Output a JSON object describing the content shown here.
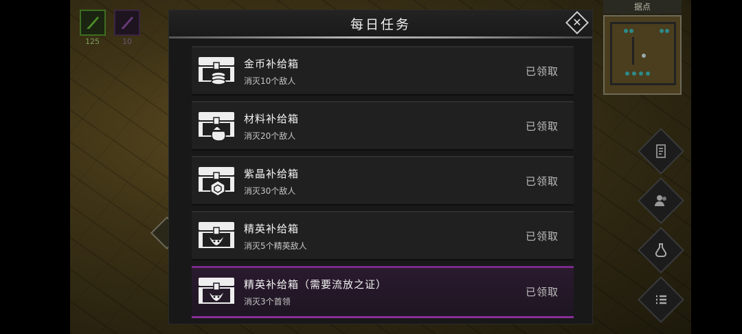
{
  "hud": {
    "skill_1_count": "125",
    "skill_2_count": "10",
    "minimap_title": "据点"
  },
  "dialog": {
    "title": "每日任务",
    "close_glyph": "✕"
  },
  "quests": [
    {
      "name": "金币补给箱",
      "desc": "消灭10个敌人",
      "status": "已领取",
      "icon": "coin-chest-icon"
    },
    {
      "name": "材料补给箱",
      "desc": "消灭20个敌人",
      "status": "已领取",
      "icon": "material-chest-icon"
    },
    {
      "name": "紫晶补给箱",
      "desc": "消灭30个敌人",
      "status": "已领取",
      "icon": "crystal-chest-icon"
    },
    {
      "name": "精英补给箱",
      "desc": "消灭5个精英敌人",
      "status": "已领取",
      "icon": "elite-chest-icon"
    },
    {
      "name": "精英补给箱（需要流放之证）",
      "desc": "消灭3个首领",
      "status": "已领取",
      "icon": "boss-chest-icon"
    }
  ],
  "colors": {
    "elite_border": "#8a2e9a",
    "status_text": "#bdbdbd"
  }
}
